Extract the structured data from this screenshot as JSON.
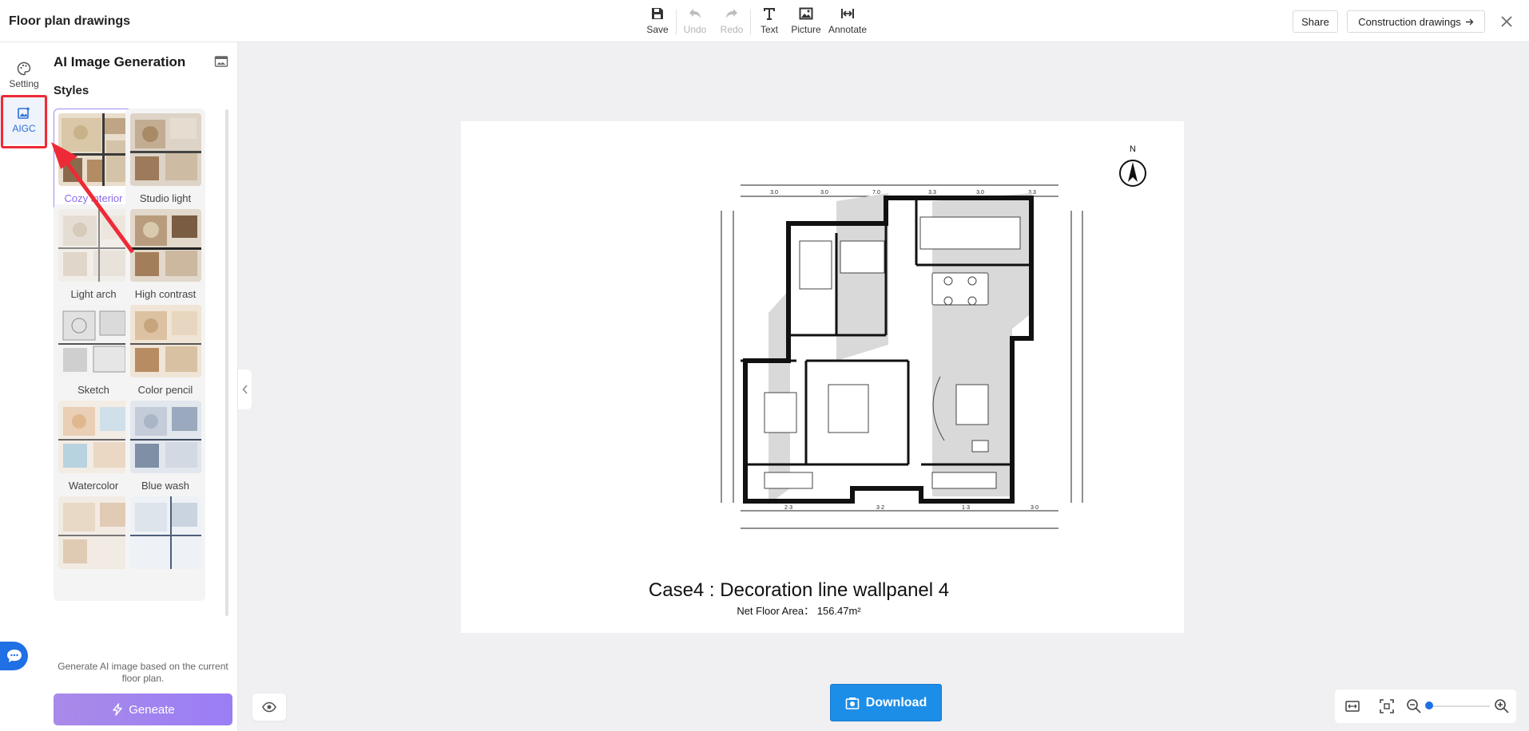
{
  "app": {
    "title": "Floor plan drawings"
  },
  "toolbar": {
    "save": "Save",
    "undo": "Undo",
    "redo": "Redo",
    "text": "Text",
    "picture": "Picture",
    "annotate": "Annotate"
  },
  "header_actions": {
    "share": "Share",
    "construction": "Construction drawings"
  },
  "rail": {
    "setting": "Setting",
    "aigc": "AIGC"
  },
  "panel": {
    "title": "AI Image Generation",
    "styles_heading": "Styles",
    "styles": [
      {
        "label": "Cozy interior",
        "selected": true
      },
      {
        "label": "Studio light",
        "selected": false
      },
      {
        "label": "Light arch",
        "selected": false
      },
      {
        "label": "High contrast",
        "selected": false
      },
      {
        "label": "Sketch",
        "selected": false
      },
      {
        "label": "Color pencil",
        "selected": false
      },
      {
        "label": "Watercolor",
        "selected": false
      },
      {
        "label": "Blue wash",
        "selected": false
      },
      {
        "label": "",
        "selected": false
      },
      {
        "label": "",
        "selected": false
      }
    ],
    "hint": "Generate AI image based on the current floor plan.",
    "generate": "Geneate"
  },
  "canvas": {
    "compass": "N",
    "case_title": "Case4 : Decoration line wallpanel 4",
    "area": "Net Floor Area： 156.47m²",
    "dims_top": [
      "3.0",
      "3.0",
      "7.0",
      "3.3",
      "3.0",
      "3.3"
    ],
    "dims_bottom": [
      "2·3",
      "3·2",
      "1·3",
      "3·0"
    ]
  },
  "download": "Download",
  "colors": {
    "accent": "#1f6fe5",
    "download": "#1d8ee8",
    "generate": "#a98ae9",
    "selected_border": "#a58bf0",
    "highlight": "#ee2a36"
  }
}
